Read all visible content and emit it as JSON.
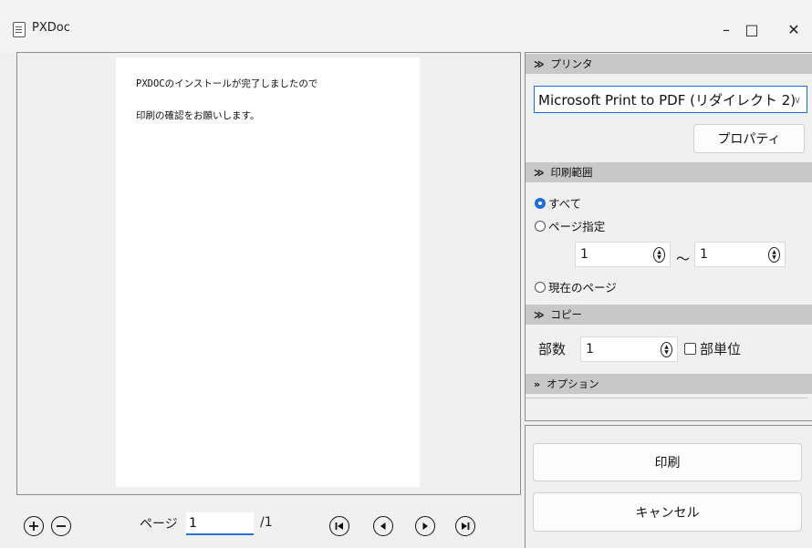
{
  "window": {
    "title": "PXDoc",
    "minimize_glyph": "–",
    "maximize_glyph": "□",
    "close_glyph": "✕"
  },
  "preview": {
    "lines": [
      "PXDOCのインストールが完了しましたので",
      "印刷の確認をお願いします。"
    ]
  },
  "nav": {
    "page_label": "ページ",
    "page_value": "1",
    "page_total": "/1"
  },
  "printer": {
    "section_title": "プリンタ",
    "selected": "Microsoft Print to PDF (リダイレクト 2)",
    "properties_button": "プロパティ"
  },
  "range": {
    "section_title": "印刷範囲",
    "option_all": "すべて",
    "option_pages": "ページ指定",
    "from_value": "1",
    "tilde": "～",
    "to_value": "1",
    "option_current": "現在のページ",
    "selected": "all"
  },
  "copies": {
    "section_title": "コピー",
    "label": "部数",
    "value": "1",
    "collate_label": "部単位"
  },
  "options": {
    "section_title": "オプション"
  },
  "actions": {
    "print_button": "印刷",
    "cancel_button": "キャンセル"
  },
  "colors": {
    "accent": "#1a6dd6",
    "section_header": "#c8c8c8"
  }
}
